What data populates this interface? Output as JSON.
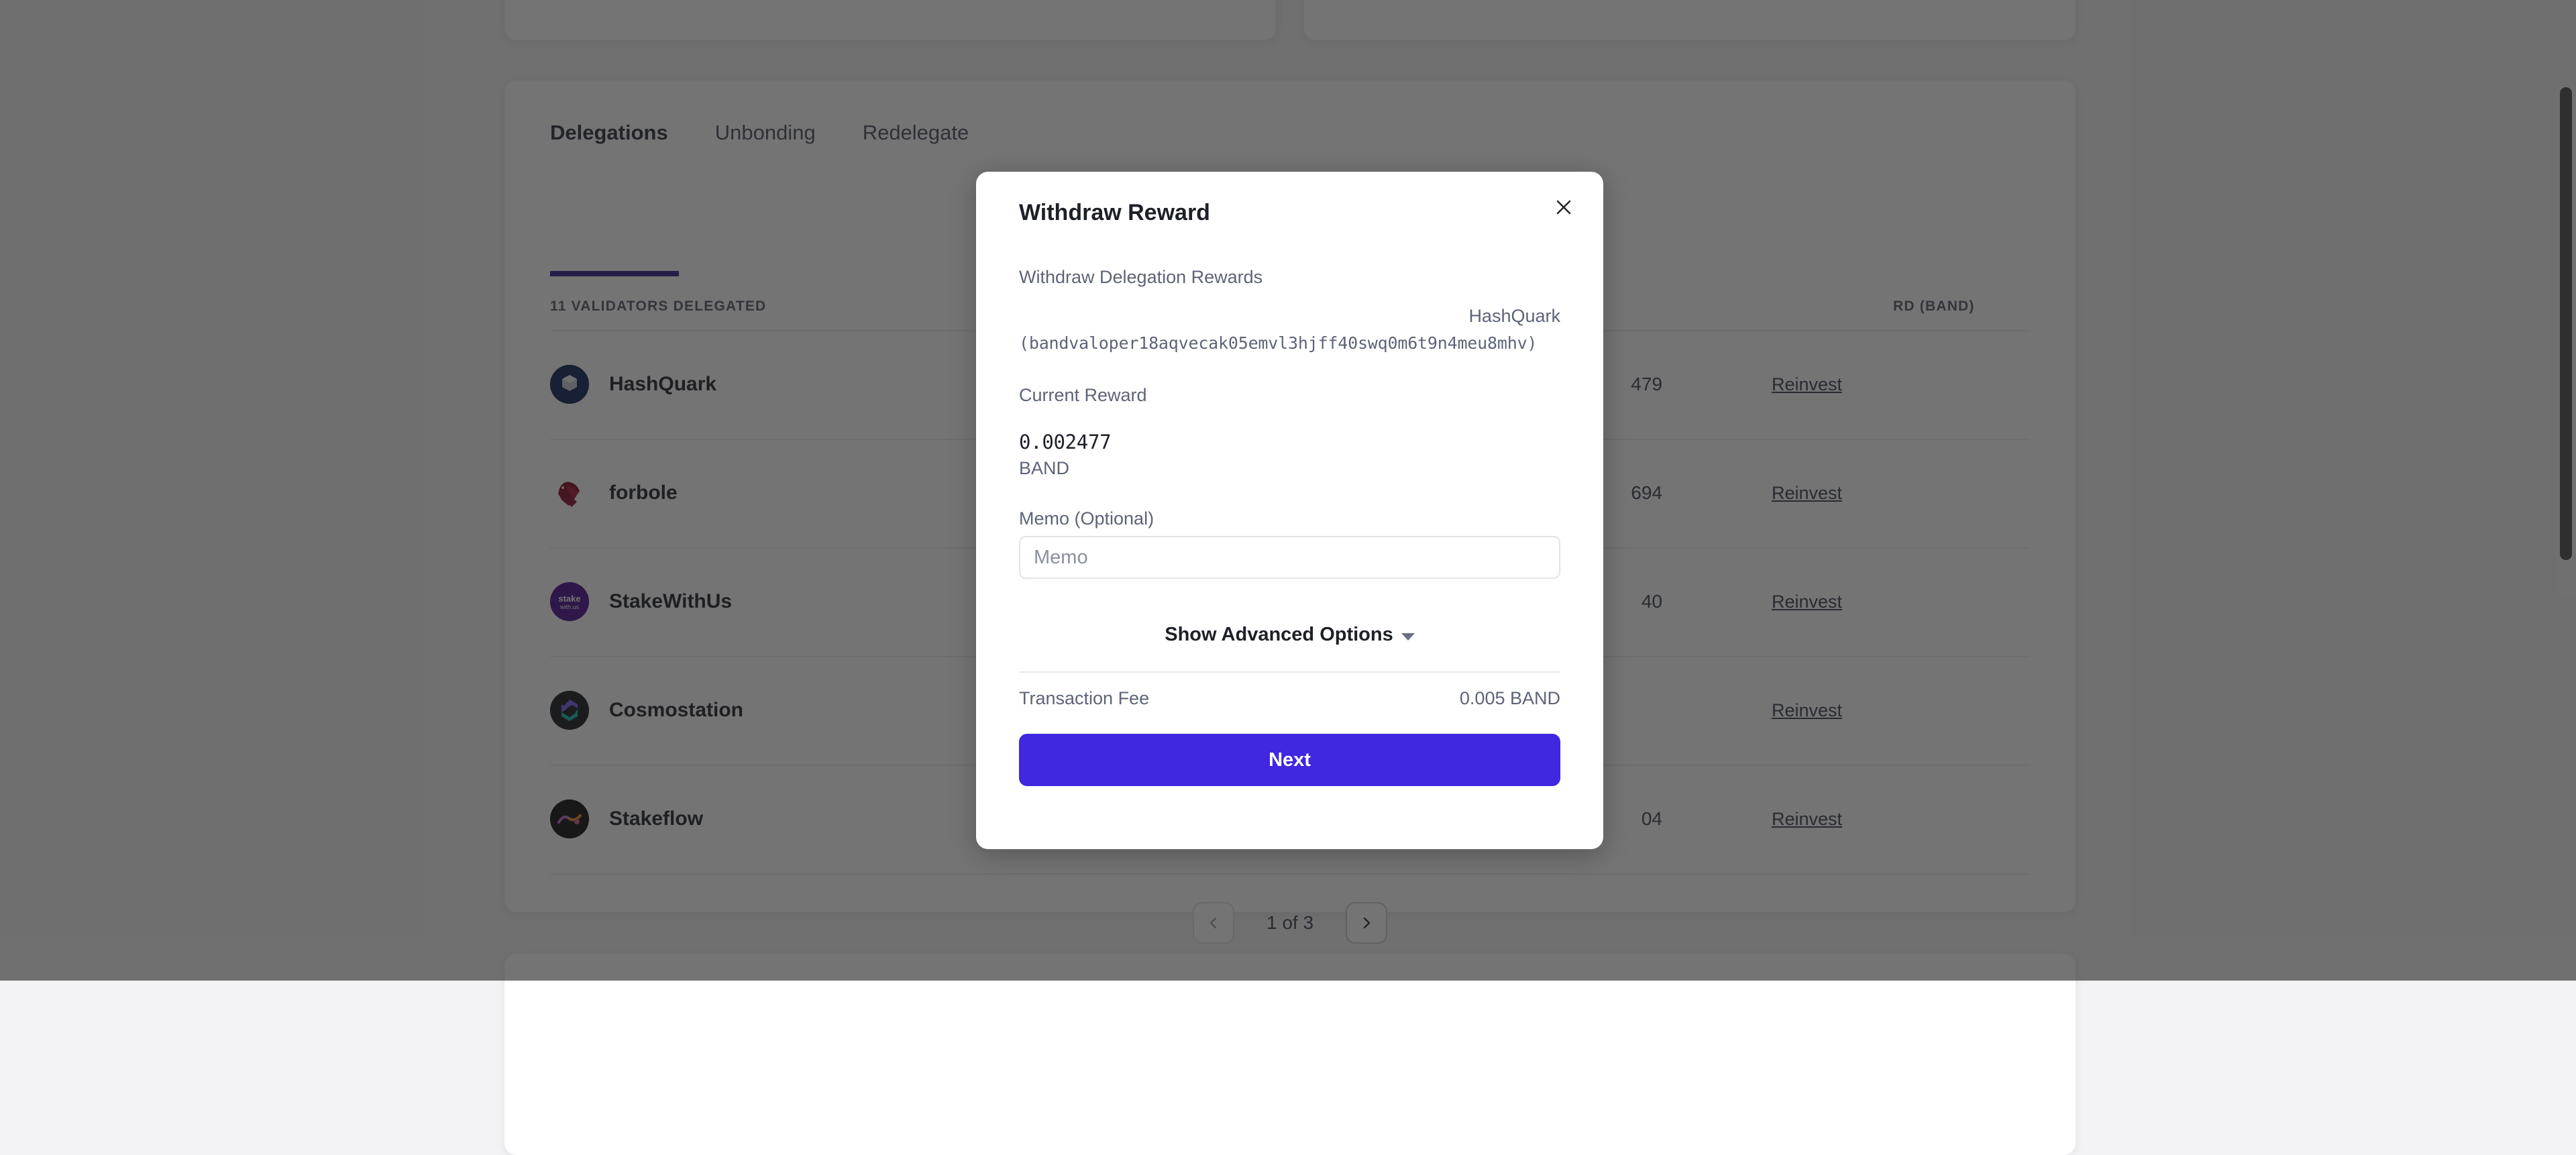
{
  "background": {
    "tabs": [
      {
        "label": "Delegations",
        "active": true
      },
      {
        "label": "Unbonding",
        "active": false
      },
      {
        "label": "Redelegate",
        "active": false
      }
    ],
    "validators_count_label": "11 VALIDATORS DELEGATED",
    "columns": {
      "validators": "11 VALIDATORS DELEGATED",
      "reward": "RD (BAND)"
    },
    "rows": [
      {
        "name": "HashQuark",
        "logo": "hashquark-logo",
        "reward": "479",
        "action": "Reinvest"
      },
      {
        "name": "forbole",
        "logo": "forbole-logo",
        "reward": "694",
        "action": "Reinvest"
      },
      {
        "name": "StakeWithUs",
        "logo": "stakewithus-logo",
        "reward": "40",
        "action": "Reinvest"
      },
      {
        "name": "Cosmostation",
        "logo": "cosmostation-logo",
        "reward": "",
        "action": "Reinvest"
      },
      {
        "name": "Stakeflow",
        "logo": "stakeflow-logo",
        "reward": "04",
        "action": "Reinvest"
      }
    ],
    "pagination": {
      "prev_icon": "chevron-left-icon",
      "next_icon": "chevron-right-icon",
      "label": "1 of 3"
    }
  },
  "modal": {
    "title": "Withdraw Reward",
    "close_icon": "close-icon",
    "subtitle": "Withdraw Delegation Rewards",
    "validator_name": "HashQuark",
    "validator_address": "(bandvaloper18aqvecak05emvl3hjff40swq0m6t9n4meu8mhv)",
    "current_reward_label": "Current Reward",
    "reward_amount": "0.002477",
    "reward_denom": "BAND",
    "memo_label": "Memo (Optional)",
    "memo_value": "",
    "memo_placeholder": "Memo",
    "advanced_options_label": "Show Advanced Options",
    "advanced_caret_icon": "chevron-down-icon",
    "transaction_fee_label": "Transaction Fee",
    "transaction_fee_value": "0.005 BAND",
    "next_label": "Next"
  },
  "colors": {
    "accent": "#4027e0",
    "tab_underline": "#2d1e8a",
    "overlay": "rgba(30,30,30,0.62)",
    "page_bg": "#f3f3f5",
    "text_primary": "#1d2029",
    "text_muted": "#5d6478"
  },
  "scrollbar": {
    "thumb": "vertical-scrollbar-thumb"
  }
}
